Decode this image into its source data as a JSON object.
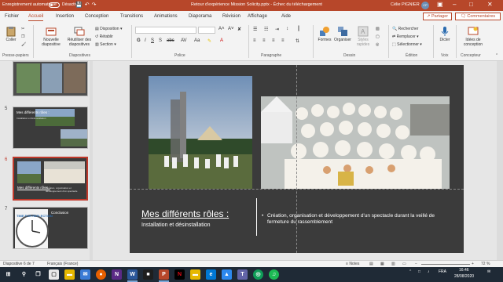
{
  "titlebar": {
    "autosave_label": "Enregistrement automatique",
    "autosave_state": "Désactivé",
    "doc_title": "Retour d'expérience Mission Solicity.pptx  -  Échec du téléchargement",
    "user_name": "Célie PIGNIER",
    "user_initials": "CP"
  },
  "tabs": [
    "Fichier",
    "Accueil",
    "Insertion",
    "Conception",
    "Transitions",
    "Animations",
    "Diaporama",
    "Révision",
    "Affichage",
    "Aide"
  ],
  "active_tab": "Accueil",
  "share_label": "Partager",
  "comments_label": "Commentaires",
  "ribbon": {
    "paste": "Coller",
    "new_slide": "Nouvelle diapositive",
    "reuse": "Réutiliser des diapositives",
    "disposition": "Disposition",
    "reset": "Rétablir",
    "section": "Section",
    "shapes": "Formes",
    "arrange": "Organiser",
    "quick_styles": "Styles rapides",
    "find": "Rechercher",
    "replace": "Remplacer",
    "select": "Sélectionner",
    "dictate": "Dicter",
    "designer": "Idées de conception",
    "groups": {
      "clipboard": "Presse-papiers",
      "slides": "Diapositives",
      "font": "Police",
      "paragraph": "Paragraphe",
      "drawing": "Dessin",
      "editing": "Édition",
      "voice": "Voix",
      "designer": "Concepteur"
    }
  },
  "thumbnails": [
    {
      "num": "4",
      "title": "",
      "text": ""
    },
    {
      "num": "5",
      "title": "Mes différents rôles :",
      "text": "Installation et désinstallation"
    },
    {
      "num": "6",
      "title": "Mes différents rôles :",
      "text": "Création, organisation et développement d'un spectacle"
    },
    {
      "num": "7",
      "title": "Conclusion",
      "text": "TIME FOR REFLECTION"
    }
  ],
  "active_slide": "6",
  "slide": {
    "title": "Mes différents rôles :",
    "subtitle": "Installation et désinstallation",
    "bullet": "Création, organisation et développement d'un spectacle durant la veillé de fermeture du rassemblement",
    "bullet_marker": "•"
  },
  "statusbar": {
    "slide_info": "Diapositive 6 de 7",
    "language": "Français (France)",
    "notes": "Notes",
    "zoom": "72 %"
  },
  "taskbar": {
    "time": "16:46",
    "date": "28/08/2020",
    "language": "FRA"
  },
  "colors": {
    "accent": "#b7472a",
    "slide_bg": "#3b3b3b",
    "active_thumb_border": "#c0392b"
  }
}
